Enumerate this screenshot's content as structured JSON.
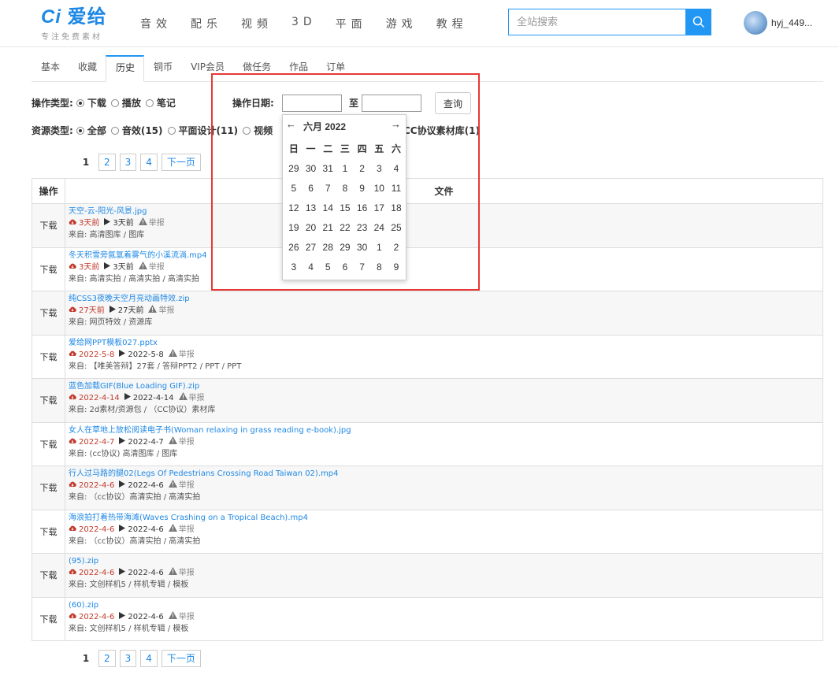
{
  "header": {
    "logo_text": "爱给",
    "logo_sub": "专注免费素材",
    "nav": [
      "音效",
      "配乐",
      "视频",
      "3D",
      "平面",
      "游戏",
      "教程"
    ],
    "search_placeholder": "全站搜索",
    "username": "hyj_449..."
  },
  "tabs": [
    "基本",
    "收藏",
    "历史",
    "铜币",
    "VIP会员",
    "做任务",
    "作品",
    "订单"
  ],
  "active_tab": "历史",
  "filters": {
    "op_type_label": "操作类型:",
    "op_types": [
      {
        "label": "下载",
        "checked": true
      },
      {
        "label": "播放",
        "checked": false
      },
      {
        "label": "笔记",
        "checked": false
      }
    ],
    "date_label": "操作日期:",
    "date_sep": "至",
    "query_label": "查询",
    "res_type_label": "资源类型:",
    "res_types": [
      {
        "label": "全部",
        "checked": true
      },
      {
        "label": "音效(15)",
        "checked": false
      },
      {
        "label": "平面设计(11)",
        "checked": false
      },
      {
        "label": "视频",
        "checked": false
      },
      {
        "label": "CC协议素材库(1)",
        "checked": false
      }
    ]
  },
  "pager": {
    "current": "1",
    "pages": [
      "2",
      "3",
      "4"
    ],
    "next": "下一页"
  },
  "table": {
    "col_op": "操作",
    "col_file": "文件",
    "rows": [
      {
        "op": "下载",
        "name": "天空-云-阳光-风景.jpg",
        "dl": "3天前",
        "play": "3天前",
        "report": "举报",
        "src": "来自: 高清图库 / 图库"
      },
      {
        "op": "下载",
        "name": "冬天积雪旁氤氲着雾气的小溪流淌.mp4",
        "dl": "3天前",
        "play": "3天前",
        "report": "举报",
        "src": "来自: 高清实拍 / 高清实拍 / 高清实拍"
      },
      {
        "op": "下载",
        "name": "纯CSS3夜晚天空月亮动画特效.zip",
        "dl": "27天前",
        "play": "27天前",
        "report": "举报",
        "src": "来自: 网页特效 / 资源库"
      },
      {
        "op": "下载",
        "name": "爱给网PPT模板027.pptx",
        "dl": "2022-5-8",
        "play": "2022-5-8",
        "report": "举报",
        "src": "来自: 【唯美答辩】27套 / 答辩PPT2 / PPT / PPT"
      },
      {
        "op": "下载",
        "name": "蓝色加载GIF(Blue Loading GIF).zip",
        "dl": "2022-4-14",
        "play": "2022-4-14",
        "report": "举报",
        "src": "来自: 2d素材/资源包 / （CC协议）素材库"
      },
      {
        "op": "下载",
        "name": "女人在草地上放松阅读电子书(Woman relaxing in grass reading e-book).jpg",
        "dl": "2022-4-7",
        "play": "2022-4-7",
        "report": "举报",
        "src": "来自: (cc协议) 高清图库 / 图库"
      },
      {
        "op": "下载",
        "name": "行人过马路的腿02(Legs Of Pedestrians Crossing Road Taiwan 02).mp4",
        "dl": "2022-4-6",
        "play": "2022-4-6",
        "report": "举报",
        "src": "来自: （cc协议）高清实拍 / 高清实拍"
      },
      {
        "op": "下载",
        "name": "海浪拍打着热带海滩(Waves Crashing on a Tropical Beach).mp4",
        "dl": "2022-4-6",
        "play": "2022-4-6",
        "report": "举报",
        "src": "来自: （cc协议）高清实拍 / 高清实拍"
      },
      {
        "op": "下载",
        "name": "(95).zip",
        "dl": "2022-4-6",
        "play": "2022-4-6",
        "report": "举报",
        "src": "来自: 文创样机5 / 样机专辑 / 模板"
      },
      {
        "op": "下载",
        "name": "(60).zip",
        "dl": "2022-4-6",
        "play": "2022-4-6",
        "report": "举报",
        "src": "来自: 文创样机5 / 样机专辑 / 模板"
      }
    ]
  },
  "calendar": {
    "title": "六月 2022",
    "prev": "←",
    "next": "→",
    "weekdays": [
      "日",
      "一",
      "二",
      "三",
      "四",
      "五",
      "六"
    ],
    "weeks": [
      [
        "29",
        "30",
        "31",
        "1",
        "2",
        "3",
        "4"
      ],
      [
        "5",
        "6",
        "7",
        "8",
        "9",
        "10",
        "11"
      ],
      [
        "12",
        "13",
        "14",
        "15",
        "16",
        "17",
        "18"
      ],
      [
        "19",
        "20",
        "21",
        "22",
        "23",
        "24",
        "25"
      ],
      [
        "26",
        "27",
        "28",
        "29",
        "30",
        "1",
        "2"
      ],
      [
        "3",
        "4",
        "5",
        "6",
        "7",
        "8",
        "9"
      ]
    ]
  },
  "colors": {
    "accent": "#2196f3",
    "link": "#1e88e5",
    "download_red": "#c0392b",
    "annotation": "#e53935"
  }
}
